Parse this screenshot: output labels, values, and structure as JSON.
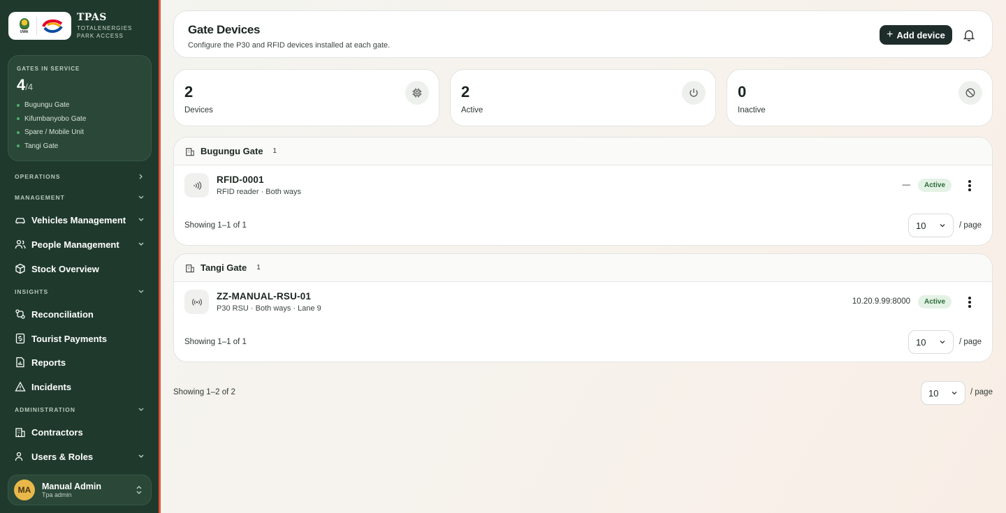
{
  "brand": {
    "title": "TPAS",
    "subtitle_line1": "TOTALENERGIES",
    "subtitle_line2": "PARK ACCESS",
    "uwa_text": "UWA"
  },
  "gates_panel": {
    "label": "GATES IN SERVICE",
    "count": "4",
    "total": "/4",
    "gates": [
      "Bugungu Gate",
      "Kifumbanyobo Gate",
      "Spare / Mobile Unit",
      "Tangi Gate"
    ]
  },
  "sidebar": {
    "operations": "OPERATIONS",
    "management": "MANAGEMENT",
    "vehicles": "Vehicles Management",
    "people": "People Management",
    "stock": "Stock Overview",
    "insights": "INSIGHTS",
    "reconciliation": "Reconciliation",
    "tourist_payments": "Tourist Payments",
    "reports": "Reports",
    "incidents": "Incidents",
    "administration": "ADMINISTRATION",
    "contractors": "Contractors",
    "users_roles": "Users & Roles"
  },
  "user": {
    "initials": "MA",
    "name": "Manual Admin",
    "role": "Tpa admin"
  },
  "header": {
    "title": "Gate Devices",
    "subtitle": "Configure the P30 and RFID devices installed at each gate.",
    "add_label": "Add device",
    "add_plus": "+"
  },
  "stats": [
    {
      "value": "2",
      "label": "Devices",
      "icon": "chip-icon"
    },
    {
      "value": "2",
      "label": "Active",
      "icon": "power-icon"
    },
    {
      "value": "0",
      "label": "Inactive",
      "icon": "ban-icon"
    }
  ],
  "groups": [
    {
      "name": "Bugungu Gate",
      "count": "1",
      "device": {
        "name": "RFID-0001",
        "desc": "RFID reader · Both ways",
        "address": "—",
        "status": "Active",
        "icon": "rfid-icon"
      },
      "showing": "Showing 1–1 of 1",
      "page_size": "10",
      "per_page": "/ page"
    },
    {
      "name": "Tangi Gate",
      "count": "1",
      "device": {
        "name": "ZZ-MANUAL-RSU-01",
        "desc": "P30 RSU · Both ways · Lane 9",
        "address": "10.20.9.99:8000",
        "status": "Active",
        "icon": "antenna-icon"
      },
      "showing": "Showing 1–1 of 1",
      "page_size": "10",
      "per_page": "/ page"
    }
  ],
  "footer": {
    "showing": "Showing 1–2 of 2",
    "page_size": "10",
    "per_page": "/ page"
  },
  "colors": {
    "sidebar": "#1f3a2c",
    "accent_line": "#e0543b",
    "primary_button": "#1f2d2a",
    "active_badge_bg": "#e3f2e5",
    "active_badge_text": "#2c6b3a"
  }
}
